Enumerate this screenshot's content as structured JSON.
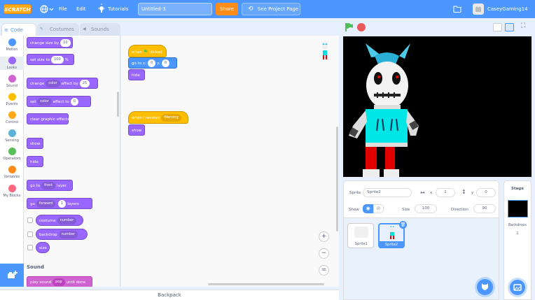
{
  "menubar": {
    "logo": "SCRATCH",
    "file": "File",
    "edit": "Edit",
    "tutorials": "Tutorials",
    "project_title": "Untitled-3",
    "share": "Share",
    "see_project_page": "See Project Page",
    "username": "CaseyGaming14"
  },
  "tabs": {
    "code": "Code",
    "costumes": "Costumes",
    "sounds": "Sounds"
  },
  "categories": [
    {
      "label": "Motion",
      "color": "#4c97ff"
    },
    {
      "label": "Looks",
      "color": "#9966ff"
    },
    {
      "label": "Sound",
      "color": "#cf63cf"
    },
    {
      "label": "Events",
      "color": "#ffbf00"
    },
    {
      "label": "Control",
      "color": "#ffab19"
    },
    {
      "label": "Sensing",
      "color": "#5cb1d6"
    },
    {
      "label": "Operators",
      "color": "#59c059"
    },
    {
      "label": "Variables",
      "color": "#ff8c1a"
    },
    {
      "label": "My Blocks",
      "color": "#ff6680"
    }
  ],
  "palette": {
    "change_size": "change size by",
    "change_size_val": "10",
    "set_size": "set size to",
    "set_size_val": "100",
    "set_size_unit": "%",
    "change_effect": "change",
    "change_effect_dd": "color",
    "change_effect_by": "effect by",
    "change_effect_val": "25",
    "set_effect": "set",
    "set_effect_dd": "color",
    "set_effect_to": "effect to",
    "set_effect_val": "0",
    "clear_effects": "clear graphic effects",
    "show": "show",
    "hide": "hide",
    "go_to": "go to",
    "go_to_dd": "front",
    "go_to_layer": "layer",
    "go_layers": "go",
    "go_layers_dd": "forward",
    "go_layers_val": "1",
    "go_layers_word": "layers",
    "costume": "costume",
    "costume_dd": "number",
    "backdrop": "backdrop",
    "backdrop_dd": "number",
    "size": "size",
    "sound_header": "Sound",
    "play_sound": "play sound",
    "play_sound_dd": "pop",
    "play_sound_until": "until done"
  },
  "scripts": {
    "when": "when",
    "clicked": "clicked",
    "go_to": "go to x:",
    "x_val": "0",
    "y_label": "y:",
    "y_val": "0",
    "hide": "hide",
    "when_receive": "when I receive",
    "message": "Warning",
    "show": "show"
  },
  "sprite_info": {
    "sprite_label": "Sprite",
    "sprite_name": "Sprite2",
    "x_label": "x",
    "x_val": "1",
    "y_label": "y",
    "y_val": "0",
    "show_label": "Show",
    "size_label": "Size",
    "size_val": "100",
    "direction_label": "Direction",
    "direction_val": "90"
  },
  "sprites": [
    {
      "name": "Sprite1"
    },
    {
      "name": "Sprite2"
    }
  ],
  "stage_panel": {
    "title": "Stage",
    "backdrops_label": "Backdrops",
    "backdrops_count": "1"
  },
  "backpack": "Backpack"
}
